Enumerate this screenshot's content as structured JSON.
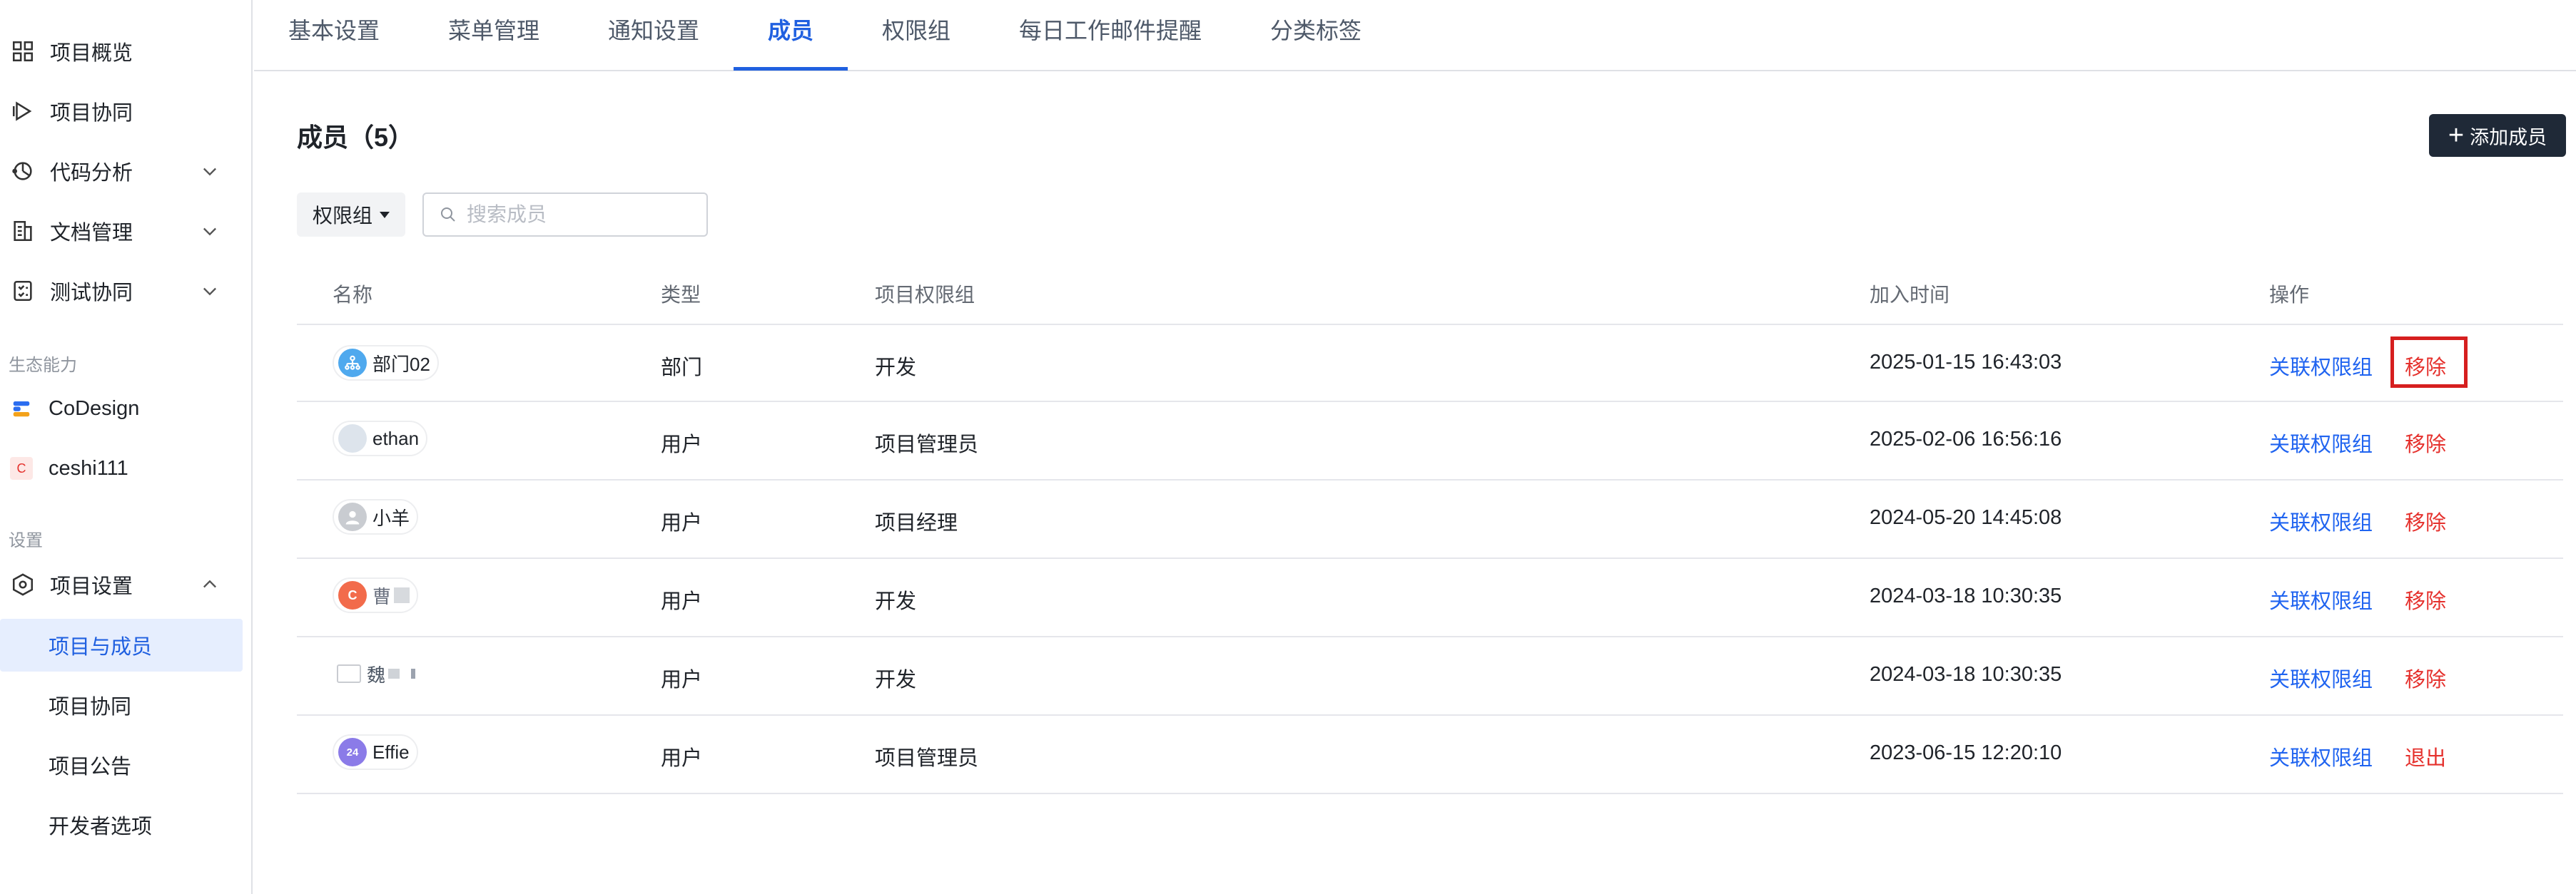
{
  "sidebar": {
    "items": [
      {
        "label": "项目概览",
        "icon": "grid-icon"
      },
      {
        "label": "项目协同",
        "icon": "play-icon"
      },
      {
        "label": "代码分析",
        "icon": "code-analysis-icon"
      },
      {
        "label": "文档管理",
        "icon": "document-icon"
      },
      {
        "label": "测试协同",
        "icon": "checklist-icon"
      }
    ],
    "ecosystem_label": "生态能力",
    "ecosystem": [
      {
        "label": "CoDesign",
        "icon": "codesign-logo"
      },
      {
        "label": "ceshi111",
        "badge": "C"
      }
    ],
    "settings_label": "设置",
    "settings_group": "项目设置",
    "settings_subitems": [
      "项目与成员",
      "项目协同",
      "项目公告",
      "开发者选项"
    ]
  },
  "tabs": [
    "基本设置",
    "菜单管理",
    "通知设置",
    "成员",
    "权限组",
    "每日工作邮件提醒",
    "分类标签"
  ],
  "active_tab": "成员",
  "page": {
    "title": "成员（5）",
    "add_button": "添加成员",
    "filter_label": "权限组",
    "search_placeholder": "搜索成员"
  },
  "table": {
    "headers": {
      "name": "名称",
      "type": "类型",
      "group": "项目权限组",
      "joined": "加入时间",
      "actions": "操作"
    },
    "rows": [
      {
        "name": "部门02",
        "type": "部门",
        "group": "开发",
        "joined": "2025-01-15 16:43:03",
        "action1": "关联权限组",
        "action2": "移除"
      },
      {
        "name": "ethan",
        "type": "用户",
        "group": "项目管理员",
        "joined": "2025-02-06 16:56:16",
        "action1": "关联权限组",
        "action2": "移除"
      },
      {
        "name": "小羊",
        "type": "用户",
        "group": "项目经理",
        "joined": "2024-05-20 14:45:08",
        "action1": "关联权限组",
        "action2": "移除"
      },
      {
        "name": "曹",
        "avatar_text": "C",
        "type": "用户",
        "group": "开发",
        "joined": "2024-03-18 10:30:35",
        "action1": "关联权限组",
        "action2": "移除"
      },
      {
        "name": "魏",
        "type": "用户",
        "group": "开发",
        "joined": "2024-03-18 10:30:35",
        "action1": "关联权限组",
        "action2": "移除"
      },
      {
        "name": "Effie",
        "avatar_text": "24",
        "type": "用户",
        "group": "项目管理员",
        "joined": "2023-06-15 12:20:10",
        "action1": "关联权限组",
        "action2": "退出"
      }
    ]
  },
  "colors": {
    "accent": "#2060e0",
    "danger": "#e5312d",
    "highlight": "#d61f1f"
  }
}
